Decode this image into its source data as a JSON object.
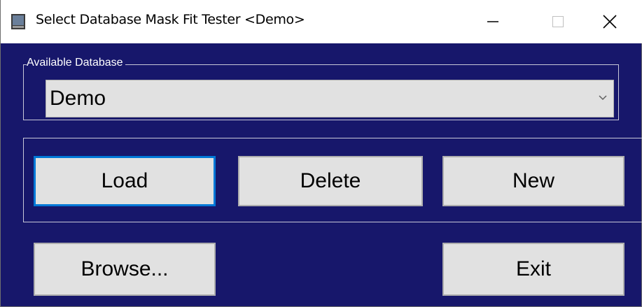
{
  "window": {
    "title": "Select Database Mask Fit Tester <Demo>",
    "background_color": "#17176b",
    "controls": {
      "minimize_icon": "minimize-icon",
      "maximize_icon": "maximize-icon",
      "close_icon": "close-icon"
    }
  },
  "database_group": {
    "legend": "Available Database",
    "selected_value": "Demo"
  },
  "actions": {
    "load_label": "Load",
    "delete_label": "Delete",
    "new_label": "New"
  },
  "footer": {
    "browse_label": "Browse...",
    "exit_label": "Exit"
  },
  "colors": {
    "button_face": "#e1e1e1",
    "focus_border": "#0078d7"
  }
}
